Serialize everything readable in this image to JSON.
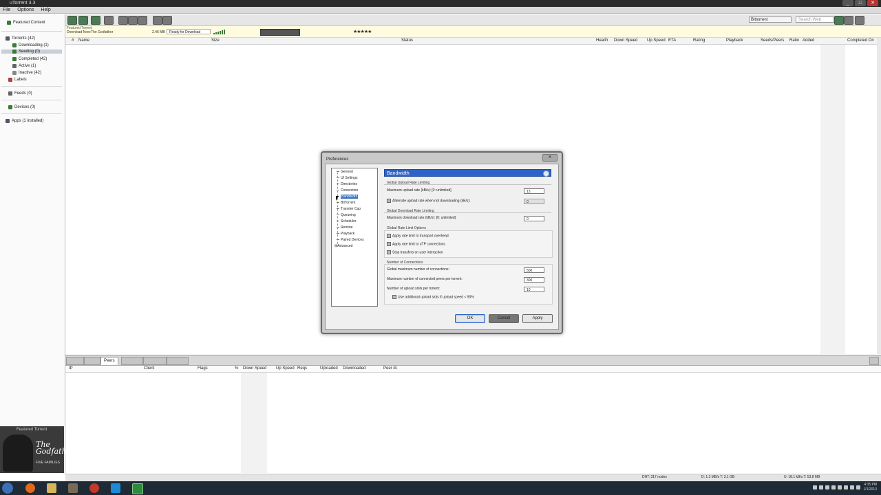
{
  "window": {
    "title": "uTorrent 3.3",
    "controls": [
      "_",
      "□",
      "✕"
    ]
  },
  "menu": [
    "File",
    "Options",
    "Help"
  ],
  "toolbar": {
    "search_placeholder": "Search Web",
    "search_provider": "Bittorrent"
  },
  "sidebar": {
    "featured": "Featured Content",
    "torrents": "Torrents (42)",
    "downloading": "Downloading (1)",
    "seeding": "Seeding (0)",
    "completed": "Completed (42)",
    "active": "Active (1)",
    "inactive": "Inactive (42)",
    "labels": "Labels",
    "feeds": "Feeds (0)",
    "devices": "Devices (0)",
    "apps": "Apps (1 installed)",
    "promo_label": "Featured Torrent",
    "promo_title": "The Godfather",
    "promo_sub": "FIVE FAMILIES"
  },
  "banner": {
    "line1": "Featured Torrent",
    "line2": "Download Now:The Godfather",
    "size": "2.46 MB",
    "ready": "Ready for Download",
    "stars": "★★★★★"
  },
  "columns": [
    "#",
    "Name",
    "Size",
    "Status",
    "Health",
    "Down Speed",
    "Up Speed",
    "ETA",
    "Rating",
    "Playback",
    "Seeds/Peers",
    "Ratio",
    "Added",
    "Completed On"
  ],
  "bottom": {
    "peers_tab": "Peers",
    "peer_columns": [
      "IP",
      "Client",
      "Flags",
      "%",
      "Down Speed",
      "Up Speed",
      "Reqs",
      "Uploaded",
      "Downloaded",
      "Peer dl."
    ]
  },
  "statusbar": {
    "dht": "DHT: 317 nodes",
    "down": "D: 1.3 MB/s T: 3.1 GB",
    "up": "U: 18.1 kB/s T: 53.8 MB"
  },
  "clock": {
    "time": "4:35 PM",
    "date": "1/1/2013"
  },
  "dialog": {
    "title": "Preferences",
    "close": "Close",
    "tree": [
      "General",
      "UI Settings",
      "Directories",
      "Connection",
      "Bandwidth",
      "BitTorrent",
      "Transfer Cap",
      "Queueing",
      "Scheduler",
      "Remote",
      "Playback",
      "Paired Devices",
      "Advanced"
    ],
    "panel_title": "Bandwidth",
    "upload_group": "Global Upload Rate Limiting",
    "max_upload_label": "Maximum upload rate (kB/s): [0: unlimited]",
    "max_upload_value": "13",
    "alt_upload_label": "Alternate upload rate when not downloading (kB/s):",
    "alt_upload_value": "0",
    "download_group": "Global Download Rate Limiting",
    "max_download_label": "Maximum download rate (kB/s): [0: unlimited]",
    "max_download_value": "0",
    "limit_group": "Global Rate Limit Options",
    "opt1": "Apply rate limit to transport overhead",
    "opt2": "Apply rate limit to uTP connections",
    "opt3": "Stop transfers on user interaction",
    "conn_group": "Number of Connections",
    "global_conn_label": "Global maximum number of connections:",
    "global_conn_value": "500",
    "peers_label": "Maximum number of connected peers per torrent:",
    "peers_value": "300",
    "slots_label": "Number of upload slots per torrent:",
    "slots_value": "10",
    "extra_slots": "Use additional upload slots if upload speed < 90%",
    "ok": "OK",
    "cancel": "Cancel",
    "apply": "Apply"
  }
}
